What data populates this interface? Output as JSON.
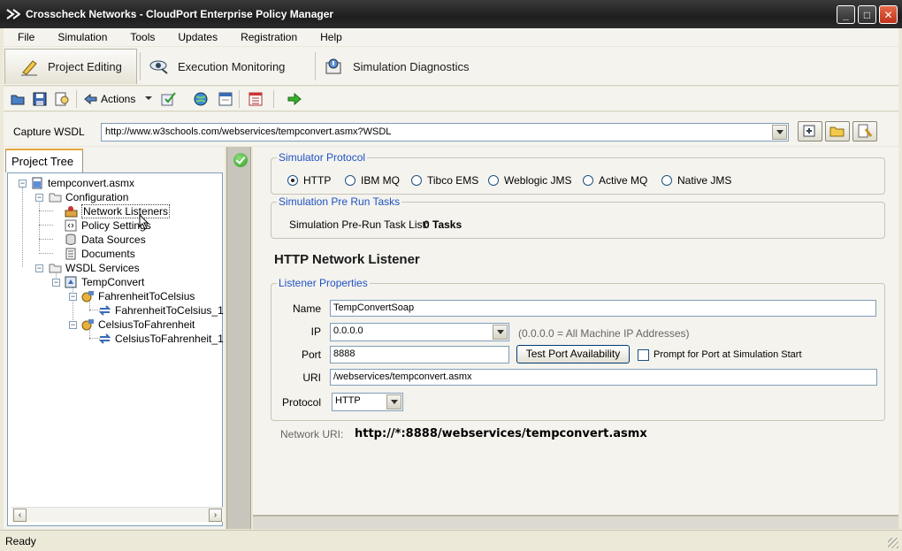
{
  "window": {
    "title": "Crosscheck Networks - CloudPort Enterprise Policy Manager"
  },
  "menu": [
    "File",
    "Simulation",
    "Tools",
    "Updates",
    "Registration",
    "Help"
  ],
  "perspectives": [
    {
      "label": "Project Editing",
      "icon": "pencil-icon",
      "active": true
    },
    {
      "label": "Execution Monitoring",
      "icon": "monitor-eye-icon",
      "active": false
    },
    {
      "label": "Simulation Diagnostics",
      "icon": "diagnostics-icon",
      "active": false
    }
  ],
  "toolbar": {
    "actions_label": "Actions"
  },
  "wsdl": {
    "label": "Capture WSDL",
    "url": "http://www.w3schools.com/webservices/tempconvert.asmx?WSDL"
  },
  "project_tree": {
    "tab_label": "Project Tree",
    "nodes": [
      "tempconvert.asmx",
      "Configuration",
      "Network Listeners",
      "Policy Settings",
      "Data Sources",
      "Documents",
      "WSDL Services",
      "TempConvert",
      "FahrenheitToCelsius",
      "FahrenheitToCelsius_1",
      "CelsiusToFahrenheit",
      "CelsiusToFahrenheit_1"
    ]
  },
  "simulator_protocol": {
    "title": "Simulator Protocol",
    "options": [
      "HTTP",
      "IBM MQ",
      "Tibco EMS",
      "Weblogic JMS",
      "Active MQ",
      "Native JMS"
    ],
    "selected": "HTTP"
  },
  "pre_run": {
    "title": "Simulation Pre Run Tasks",
    "label": "Simulation Pre-Run Task List:",
    "value": "0 Tasks"
  },
  "listener": {
    "heading": "HTTP Network Listener",
    "group_title": "Listener Properties",
    "name_label": "Name",
    "name_value": "TempConvertSoap",
    "ip_label": "IP",
    "ip_value": "0.0.0.0",
    "ip_hint": "(0.0.0.0 = All Machine IP Addresses)",
    "port_label": "Port",
    "port_value": "8888",
    "test_port_button": "Test Port Availability",
    "prompt_label": "Prompt for Port at Simulation Start",
    "uri_label": "URI",
    "uri_value": "/webservices/tempconvert.asmx",
    "protocol_label": "Protocol",
    "protocol_value": "HTTP",
    "network_uri_label": "Network URI:",
    "network_uri_value": "http://*:8888/webservices/tempconvert.asmx"
  },
  "status": {
    "text": "Ready"
  },
  "colors": {
    "group_title": "#1f52c4",
    "accent_tab": "#e8a63a"
  }
}
